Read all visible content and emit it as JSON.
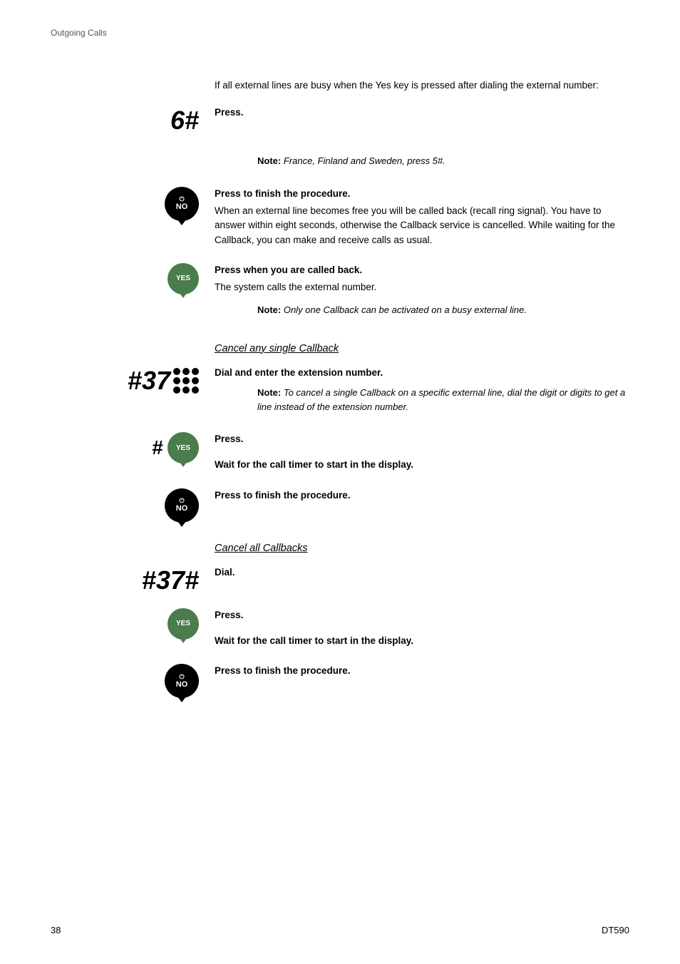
{
  "header": {
    "title": "Outgoing Calls"
  },
  "footer": {
    "page_number": "38",
    "model": "DT590"
  },
  "content": {
    "intro": {
      "text": "If all external lines are busy when the Yes key is pressed after dialing the external number:"
    },
    "step1": {
      "icon": "6#",
      "label": "Press."
    },
    "note1": {
      "label": "Note:",
      "text": "France, Finland and Sweden, press 5#."
    },
    "step2": {
      "label_bold": "Press to finish the procedure.",
      "label_detail": "When an external line becomes free you will be called back (recall ring signal). You have to answer within eight seconds, otherwise the Callback service is cancelled. While waiting for the Callback, you can make and receive calls as usual."
    },
    "step3": {
      "label_bold": "Press when you are called back.",
      "label_detail": "The system calls the external number."
    },
    "note2": {
      "label": "Note:",
      "text": "Only one Callback can be activated on a busy external line."
    },
    "section_cancel_single": {
      "heading": "Cancel any single Callback"
    },
    "step4": {
      "icon": "#37*",
      "label_bold": "Dial and enter the extension number."
    },
    "note3": {
      "label": "Note:",
      "text": "To cancel a single Callback on a specific external line, dial the digit or digits to get a line instead of the extension number."
    },
    "step5": {
      "label": "Press."
    },
    "step6": {
      "label": "Wait for the call timer to start in the display."
    },
    "step7": {
      "label": "Press to finish the procedure."
    },
    "section_cancel_all": {
      "heading": "Cancel all Callbacks"
    },
    "step8": {
      "icon": "#37#",
      "label": "Dial."
    },
    "step9": {
      "label": "Press."
    },
    "step10": {
      "label": "Wait for the call timer to start in the display."
    },
    "step11": {
      "label": "Press to finish the procedure."
    }
  }
}
